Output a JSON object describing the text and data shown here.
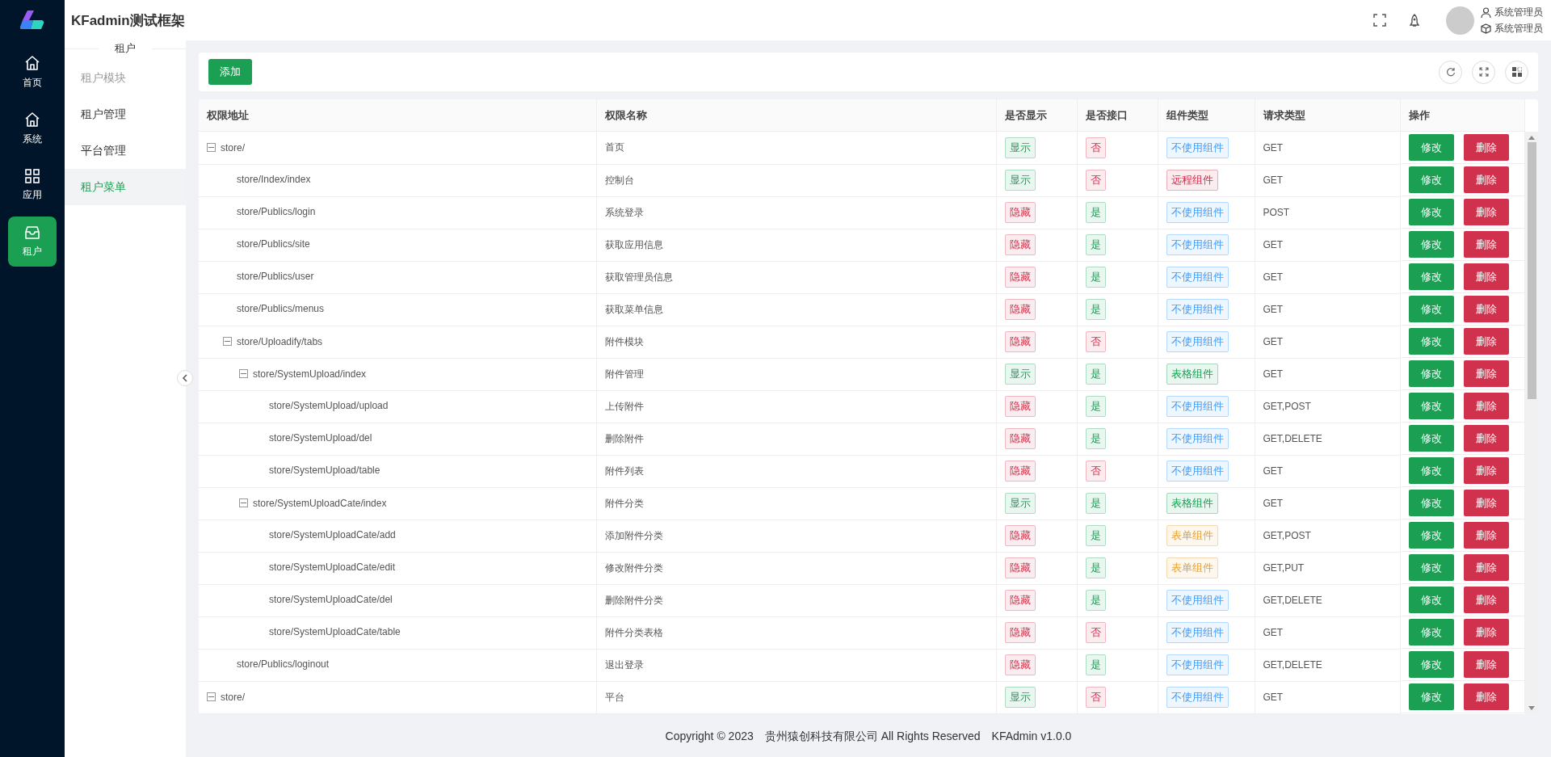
{
  "app": {
    "title": "KFadmin测试框架"
  },
  "main_nav": [
    {
      "label": "首页",
      "selected": false
    },
    {
      "label": "系统",
      "selected": false
    },
    {
      "label": "应用",
      "selected": false
    },
    {
      "label": "租户",
      "selected": true
    }
  ],
  "sub_nav": {
    "heading": "租户",
    "items": [
      {
        "label": "租户模块",
        "kind": "group"
      },
      {
        "label": "租户管理",
        "kind": "link",
        "selected": false
      },
      {
        "label": "平台管理",
        "kind": "link",
        "selected": false
      },
      {
        "label": "租户菜单",
        "kind": "link",
        "selected": true
      }
    ]
  },
  "user": {
    "name": "系统管理员",
    "role": "系统管理员"
  },
  "toolbar": {
    "add_button": "添加"
  },
  "table": {
    "columns": [
      "权限地址",
      "权限名称",
      "是否显示",
      "是否接口",
      "组件类型",
      "请求类型",
      "操作"
    ],
    "rows": [
      {
        "path": "store/",
        "name": "首页",
        "shown": true,
        "show_label": "显示",
        "is_api": false,
        "api_label": "否",
        "component": {
          "label": "不使用组件",
          "color": "#409eff"
        },
        "method": "GET",
        "edit": "修改",
        "delete": "删除",
        "expanded": true,
        "children": [
          {
            "path": "store/Index/index",
            "name": "控制台",
            "shown": true,
            "show_label": "显示",
            "is_api": false,
            "api_label": "否",
            "component": {
              "label": "远程组件",
              "color": "#d0314c"
            },
            "method": "GET",
            "edit": "修改",
            "delete": "删除"
          },
          {
            "path": "store/Publics/login",
            "name": "系统登录",
            "shown": false,
            "show_label": "隐藏",
            "is_api": true,
            "api_label": "是",
            "component": {
              "label": "不使用组件",
              "color": "#409eff"
            },
            "method": "POST",
            "edit": "修改",
            "delete": "删除"
          },
          {
            "path": "store/Publics/site",
            "name": "获取应用信息",
            "shown": false,
            "show_label": "隐藏",
            "is_api": true,
            "api_label": "是",
            "component": {
              "label": "不使用组件",
              "color": "#409eff"
            },
            "method": "GET",
            "edit": "修改",
            "delete": "删除"
          },
          {
            "path": "store/Publics/user",
            "name": "获取管理员信息",
            "shown": false,
            "show_label": "隐藏",
            "is_api": true,
            "api_label": "是",
            "component": {
              "label": "不使用组件",
              "color": "#409eff"
            },
            "method": "GET",
            "edit": "修改",
            "delete": "删除"
          },
          {
            "path": "store/Publics/menus",
            "name": "获取菜单信息",
            "shown": false,
            "show_label": "隐藏",
            "is_api": true,
            "api_label": "是",
            "component": {
              "label": "不使用组件",
              "color": "#409eff"
            },
            "method": "GET",
            "edit": "修改",
            "delete": "删除"
          },
          {
            "path": "store/Uploadify/tabs",
            "name": "附件模块",
            "shown": false,
            "show_label": "隐藏",
            "is_api": false,
            "api_label": "否",
            "component": {
              "label": "不使用组件",
              "color": "#409eff"
            },
            "method": "GET",
            "edit": "修改",
            "delete": "删除",
            "expanded": true,
            "children": [
              {
                "path": "store/SystemUpload/index",
                "name": "附件管理",
                "shown": true,
                "show_label": "显示",
                "is_api": true,
                "api_label": "是",
                "component": {
                  "label": "表格组件",
                  "color": "#1a9f53"
                },
                "method": "GET",
                "edit": "修改",
                "delete": "删除",
                "expanded": true,
                "children": [
                  {
                    "path": "store/SystemUpload/upload",
                    "name": "上传附件",
                    "shown": false,
                    "show_label": "隐藏",
                    "is_api": true,
                    "api_label": "是",
                    "component": {
                      "label": "不使用组件",
                      "color": "#409eff"
                    },
                    "method": "GET,POST",
                    "edit": "修改",
                    "delete": "删除"
                  },
                  {
                    "path": "store/SystemUpload/del",
                    "name": "删除附件",
                    "shown": false,
                    "show_label": "隐藏",
                    "is_api": true,
                    "api_label": "是",
                    "component": {
                      "label": "不使用组件",
                      "color": "#409eff"
                    },
                    "method": "GET,DELETE",
                    "edit": "修改",
                    "delete": "删除"
                  },
                  {
                    "path": "store/SystemUpload/table",
                    "name": "附件列表",
                    "shown": false,
                    "show_label": "隐藏",
                    "is_api": false,
                    "api_label": "否",
                    "component": {
                      "label": "不使用组件",
                      "color": "#409eff"
                    },
                    "method": "GET",
                    "edit": "修改",
                    "delete": "删除"
                  }
                ]
              },
              {
                "path": "store/SystemUploadCate/index",
                "name": "附件分类",
                "shown": true,
                "show_label": "显示",
                "is_api": true,
                "api_label": "是",
                "component": {
                  "label": "表格组件",
                  "color": "#1a9f53"
                },
                "method": "GET",
                "edit": "修改",
                "delete": "删除",
                "expanded": true,
                "children": [
                  {
                    "path": "store/SystemUploadCate/add",
                    "name": "添加附件分类",
                    "shown": false,
                    "show_label": "隐藏",
                    "is_api": true,
                    "api_label": "是",
                    "component": {
                      "label": "表单组件",
                      "color": "#e6a23c"
                    },
                    "method": "GET,POST",
                    "edit": "修改",
                    "delete": "删除"
                  },
                  {
                    "path": "store/SystemUploadCate/edit",
                    "name": "修改附件分类",
                    "shown": false,
                    "show_label": "隐藏",
                    "is_api": true,
                    "api_label": "是",
                    "component": {
                      "label": "表单组件",
                      "color": "#e6a23c"
                    },
                    "method": "GET,PUT",
                    "edit": "修改",
                    "delete": "删除"
                  },
                  {
                    "path": "store/SystemUploadCate/del",
                    "name": "删除附件分类",
                    "shown": false,
                    "show_label": "隐藏",
                    "is_api": true,
                    "api_label": "是",
                    "component": {
                      "label": "不使用组件",
                      "color": "#409eff"
                    },
                    "method": "GET,DELETE",
                    "edit": "修改",
                    "delete": "删除"
                  },
                  {
                    "path": "store/SystemUploadCate/table",
                    "name": "附件分类表格",
                    "shown": false,
                    "show_label": "隐藏",
                    "is_api": false,
                    "api_label": "否",
                    "component": {
                      "label": "不使用组件",
                      "color": "#409eff"
                    },
                    "method": "GET",
                    "edit": "修改",
                    "delete": "删除"
                  }
                ]
              }
            ]
          },
          {
            "path": "store/Publics/loginout",
            "name": "退出登录",
            "shown": false,
            "show_label": "隐藏",
            "is_api": true,
            "api_label": "是",
            "component": {
              "label": "不使用组件",
              "color": "#409eff"
            },
            "method": "GET,DELETE",
            "edit": "修改",
            "delete": "删除"
          }
        ]
      },
      {
        "path": "store/",
        "name": "平台",
        "shown": true,
        "show_label": "显示",
        "is_api": false,
        "api_label": "否",
        "component": {
          "label": "不使用组件",
          "color": "#409eff"
        },
        "method": "GET",
        "edit": "修改",
        "delete": "删除",
        "expanded": true
      }
    ]
  },
  "footer": {
    "copyright": "Copyright © 2023",
    "company": "贵州猿创科技有限公司 All Rights Reserved",
    "version": "KFAdmin v1.0.0"
  }
}
